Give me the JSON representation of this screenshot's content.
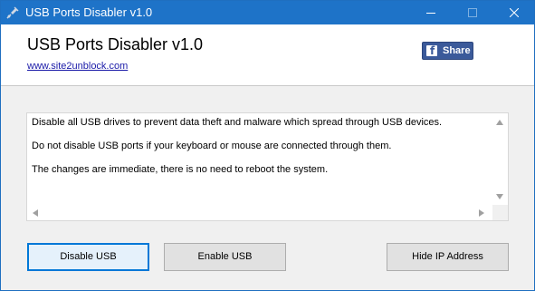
{
  "window": {
    "title": "USB Ports Disabler v1.0",
    "accent_color": "#1e73c8"
  },
  "header": {
    "app_title": "USB Ports Disabler v1.0",
    "link_text": "www.site2unblock.com",
    "share_label": "Share",
    "share_color": "#3b5a9a"
  },
  "description": {
    "lines": [
      "Disable all USB drives to prevent data theft and malware which spread through USB devices.",
      "Do not disable USB ports if your keyboard or mouse are connected through them.",
      "The changes are immediate, there is no need to reboot the system."
    ]
  },
  "buttons": {
    "disable_label": "Disable USB",
    "enable_label": "Enable USB",
    "hide_ip_label": "Hide IP Address"
  },
  "icons": {
    "app": "usb-plug-icon",
    "minimize": "minimize-icon",
    "maximize": "maximize-icon",
    "close": "close-icon",
    "share": "facebook-icon"
  }
}
